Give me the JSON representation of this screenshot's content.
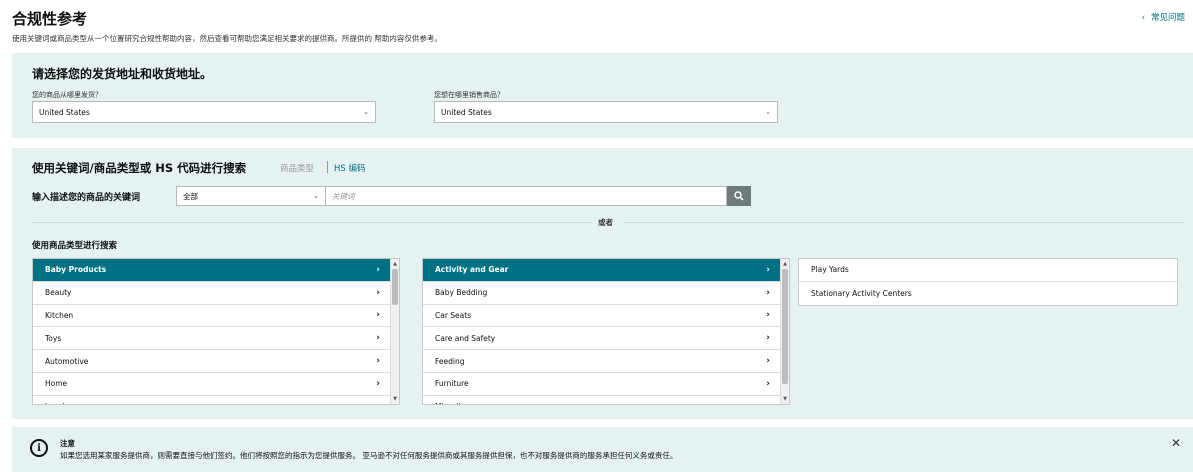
{
  "header": {
    "title": "合规性参考",
    "subtitle": "使用关键词或商品类型从一个位置研究合规性帮助内容，然后查看可帮助您满足相关要求的提供商。所提供的 帮助内容仅供参考。",
    "faq_link": "常见问题"
  },
  "address_panel": {
    "title": "请选择您的发货地址和收货地址。",
    "ship_from_label": "您的商品从哪里发货？",
    "ship_from_value": "United States",
    "ship_to_label": "您想在哪里销售商品？",
    "ship_to_value": "United States"
  },
  "search_panel": {
    "title": "使用关键词/商品类型或 HS 代码进行搜索",
    "tab_product_type": "商品类型",
    "tab_hs_code": "HS 编码",
    "keyword_label": "输入描述您的商品的关键词",
    "category_select": "全部",
    "keyword_placeholder": "关键词",
    "or_text": "或者",
    "category_label": "使用商品类型进行搜索"
  },
  "category_list_1": [
    {
      "label": "Baby Products",
      "selected": true
    },
    {
      "label": "Beauty",
      "selected": false
    },
    {
      "label": "Kitchen",
      "selected": false
    },
    {
      "label": "Toys",
      "selected": false
    },
    {
      "label": "Automotive",
      "selected": false
    },
    {
      "label": "Home",
      "selected": false
    },
    {
      "label": "Jewelry",
      "selected": false
    }
  ],
  "category_list_2": [
    {
      "label": "Activity and Gear",
      "selected": true
    },
    {
      "label": "Baby Bedding",
      "selected": false
    },
    {
      "label": "Car Seats",
      "selected": false
    },
    {
      "label": "Care and Safety",
      "selected": false
    },
    {
      "label": "Feeding",
      "selected": false
    },
    {
      "label": "Furniture",
      "selected": false
    },
    {
      "label": "Miscellaneous",
      "selected": false
    }
  ],
  "category_list_3": [
    {
      "label": "Play Yards"
    },
    {
      "label": "Stationary Activity Centers"
    }
  ],
  "notice": {
    "title": "注意",
    "text": "如果您选用某家服务提供商，则需要直接与他们签约。他们将按照您的指示为您提供服务。 亚马逊不对任何服务提供商或其服务提供担保，也不对服务提供商的服务承担任何义务或责任。"
  },
  "colors": {
    "accent": "#007185",
    "panel_bg": "#e6f2f2",
    "search_button": "#6f7a7a"
  }
}
